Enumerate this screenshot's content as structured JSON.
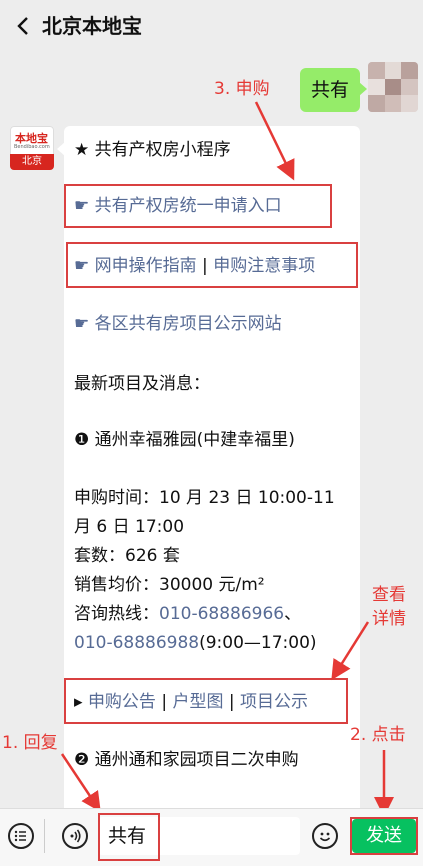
{
  "header": {
    "title": "北京本地宝"
  },
  "user_message": {
    "text": "共有"
  },
  "bot": {
    "logo_top": "本地宝",
    "logo_sub": "Bendibao.com",
    "logo_bottom": "北京",
    "items": {
      "mini_program": "★ 共有产权房小程序",
      "apply_entry": "☛ 共有产权房统一申请入口",
      "guide_icon": "☛ ",
      "guide_link": "网申操作指南",
      "guide_sep": " | ",
      "notice_link": "申购注意事项",
      "district_link": "☛ 各区共有房项目公示网站",
      "latest_title": "最新项目及消息：",
      "project1_title": "❶ 通州幸福雅园(中建幸福里)",
      "apply_time_1": "申购时间：10 月 23 日 10:00-11",
      "apply_time_2": "月 6 日 17:00",
      "units": "套数：626 套",
      "avg_price": "销售均价：30000 元/m²",
      "hotline_label": "咨询热线：",
      "hotline_1": "010-68886966",
      "hotline_sep": "、",
      "hotline_2": "010-68886988",
      "hotline_hours": "(9:00—17:00)",
      "links_prefix": "▸ ",
      "link_announcement": "申购公告",
      "link_floorplan": "户型图",
      "link_publicity": "项目公示",
      "pipe": " | ",
      "project2_title": "❷ 通州通和家园项目二次申购"
    }
  },
  "annotations": {
    "step3": "3. 申购",
    "details_1": "查看",
    "details_2": "详情",
    "step1": "1. 回复",
    "step2": "2. 点击"
  },
  "input": {
    "value": "共有"
  },
  "send_label": "发送",
  "colors": {
    "accent_green": "#07c160",
    "bubble_green": "#95ec69",
    "link": "#576b95",
    "annotation_red": "#e53935"
  }
}
